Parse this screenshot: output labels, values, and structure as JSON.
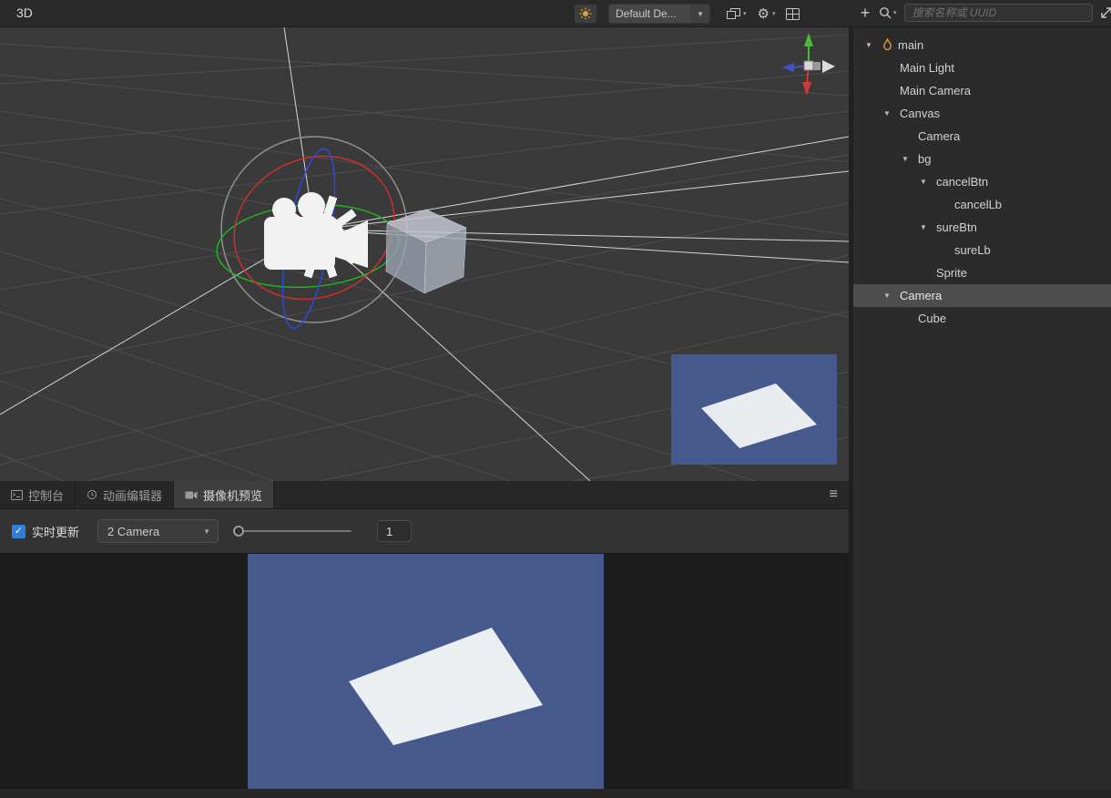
{
  "toolbar": {
    "mode_label": "3D",
    "scene_dropdown_value": "Default De...",
    "icons": [
      "sun-gizmo-icon",
      "layout-cascade-icon",
      "settings-gear-icon",
      "layout-grid-icon",
      "add-icon",
      "search-icon",
      "expand-panel-icon"
    ]
  },
  "hierarchy": {
    "search_placeholder": "搜索名称或 UUID",
    "nodes": [
      {
        "label": "main",
        "level": 0,
        "children": true,
        "icon": "flame",
        "selected": false
      },
      {
        "label": "Main Light",
        "level": 1
      },
      {
        "label": "Main Camera",
        "level": 1
      },
      {
        "label": "Canvas",
        "level": 1,
        "children": true
      },
      {
        "label": "Camera",
        "level": 2
      },
      {
        "label": "bg",
        "level": 2,
        "children": true
      },
      {
        "label": "cancelBtn",
        "level": 3,
        "children": true
      },
      {
        "label": "cancelLb",
        "level": 4
      },
      {
        "label": "sureBtn",
        "level": 3,
        "children": true
      },
      {
        "label": "sureLb",
        "level": 4
      },
      {
        "label": "Sprite",
        "level": 3
      },
      {
        "label": "Camera",
        "level": 1,
        "children": true,
        "selected": true
      },
      {
        "label": "Cube",
        "level": 2
      }
    ]
  },
  "bottom_panel": {
    "tabs": [
      {
        "id": "console",
        "label": "控制台",
        "active": false
      },
      {
        "id": "animation-editor",
        "label": "动画编辑器",
        "active": false
      },
      {
        "id": "camera-preview",
        "label": "摄像机预览",
        "active": true
      }
    ],
    "controls": {
      "realtime_label": "实时更新",
      "realtime_checked": true,
      "camera_select_value": "2 Camera",
      "scale_value": "1"
    }
  },
  "colors": {
    "accent_blue": "#2f80d9",
    "preview_background": "#45598d",
    "flame_orange": "#e09a3a",
    "selection_gray": "#4d4d4d"
  }
}
